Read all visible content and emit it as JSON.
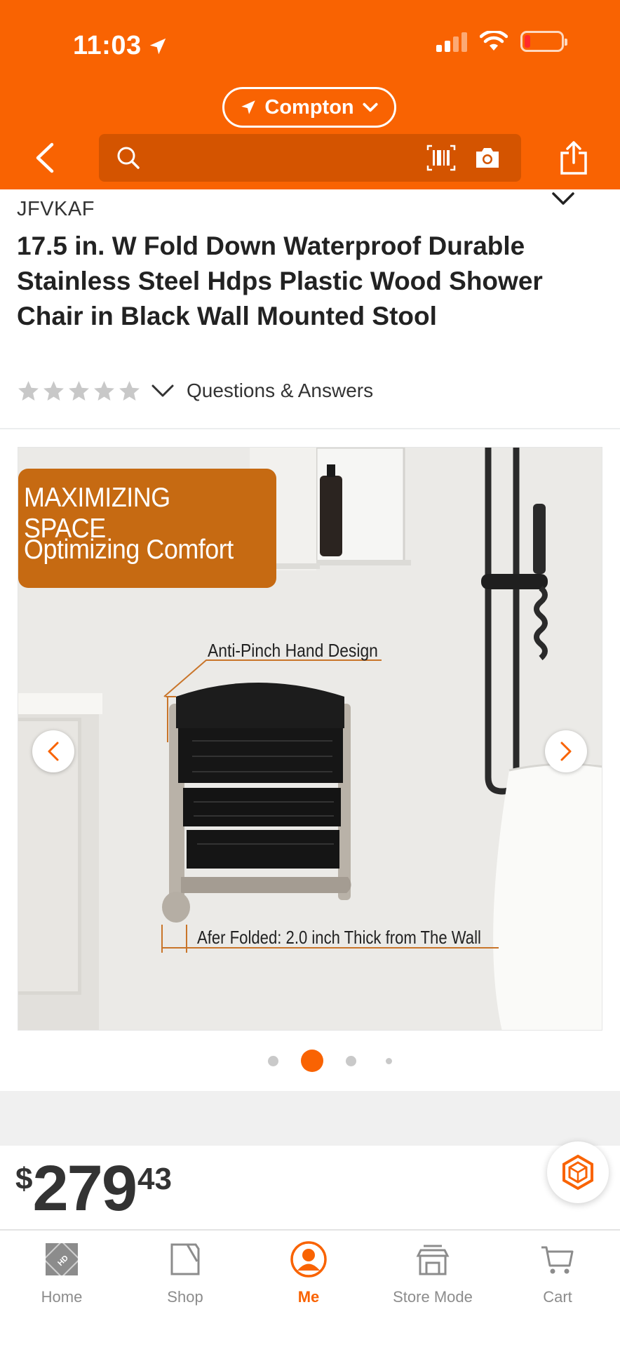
{
  "status_bar": {
    "time": "11:03"
  },
  "header": {
    "location": "Compton",
    "search_placeholder": ""
  },
  "product": {
    "brand": "JFVKAF",
    "title": "17.5 in. W Fold Down Waterproof Durable Stainless Steel Hdps Plastic Wood Shower Chair in Black Wall Mounted Stool",
    "rating_stars": 0,
    "qa_link": "Questions & Answers"
  },
  "gallery": {
    "banner_line1": "MAXIMIZING SPACE",
    "banner_line2": "Optimizing Comfort",
    "annotation_top": "Anti-Pinch Hand Design",
    "annotation_bottom": "Afer Folded: 2.0 inch Thick from The Wall",
    "slide_count": 4,
    "active_slide": 2
  },
  "price": {
    "currency": "$",
    "dollars": "279",
    "cents": "43"
  },
  "tabbar": {
    "home": "Home",
    "shop": "Shop",
    "me": "Me",
    "store_mode": "Store Mode",
    "cart": "Cart",
    "active": "me"
  },
  "colors": {
    "brand_orange": "#f96302",
    "search_bg": "#d45400",
    "text_dark": "#222222",
    "star_empty": "#c8c8c8"
  }
}
